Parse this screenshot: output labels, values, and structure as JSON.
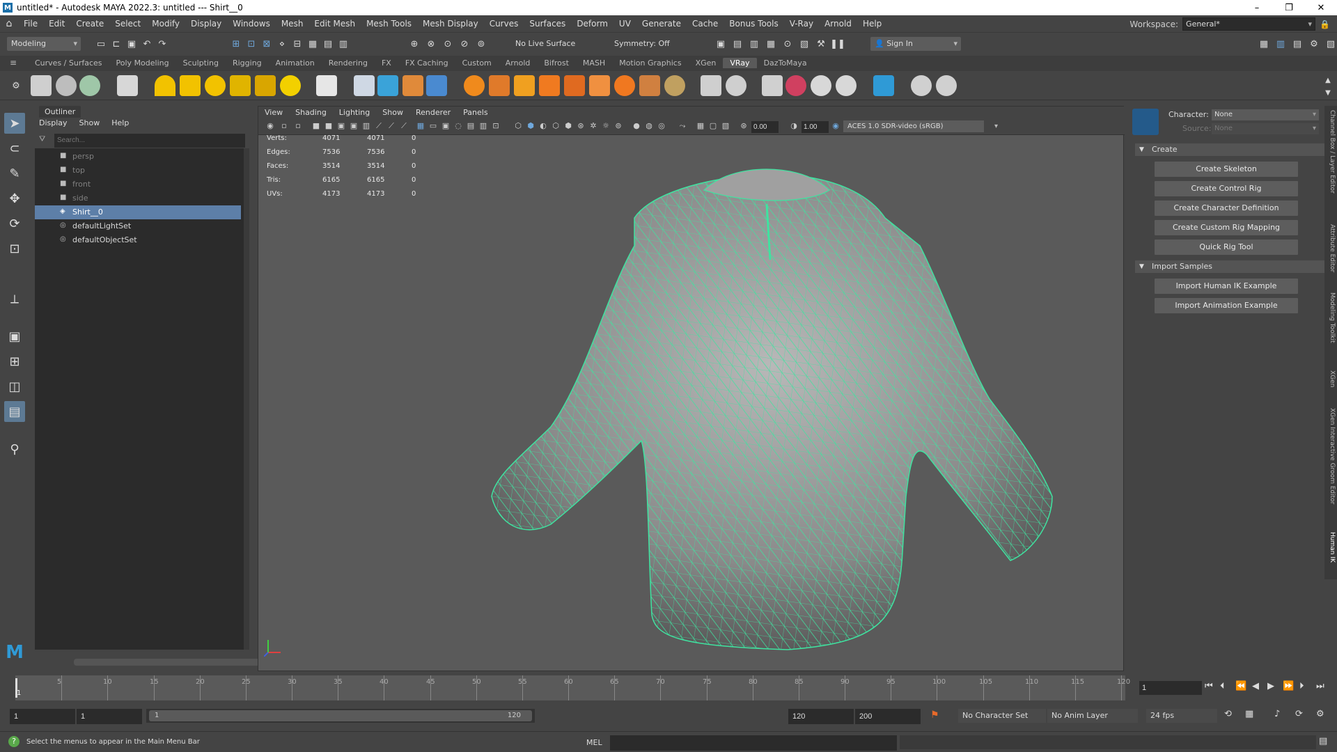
{
  "window": {
    "title": "untitled* - Autodesk MAYA 2022.3: untitled   ---   Shirt__0",
    "app_icon": "M",
    "controls": [
      "–",
      "❐",
      "✕"
    ]
  },
  "menubar": {
    "items": [
      "File",
      "Edit",
      "Create",
      "Select",
      "Modify",
      "Display",
      "Windows",
      "Mesh",
      "Edit Mesh",
      "Mesh Tools",
      "Mesh Display",
      "Curves",
      "Surfaces",
      "Deform",
      "UV",
      "Generate",
      "Cache",
      "Bonus Tools",
      "V-Ray",
      "Arnold",
      "Help"
    ],
    "workspace_label": "Workspace:",
    "workspace_value": "General*"
  },
  "statusline": {
    "mode": "Modeling",
    "live_surface": "No Live Surface",
    "symmetry": "Symmetry: Off",
    "sign_in": "Sign In"
  },
  "shelf": {
    "tabs": [
      "Curves / Surfaces",
      "Poly Modeling",
      "Sculpting",
      "Rigging",
      "Animation",
      "Rendering",
      "FX",
      "FX Caching",
      "Custom",
      "Arnold",
      "Bifrost",
      "MASH",
      "Motion Graphics",
      "XGen",
      "VRay",
      "DazToMaya"
    ],
    "active_tab": "VRay"
  },
  "outliner": {
    "title": "Outliner",
    "menu": [
      "Display",
      "Show",
      "Help"
    ],
    "search_placeholder": "Search...",
    "items": [
      {
        "label": "persp",
        "type": "camera"
      },
      {
        "label": "top",
        "type": "camera"
      },
      {
        "label": "front",
        "type": "camera"
      },
      {
        "label": "side",
        "type": "camera"
      },
      {
        "label": "Shirt__0",
        "type": "mesh",
        "selected": true
      },
      {
        "label": "defaultLightSet",
        "type": "set"
      },
      {
        "label": "defaultObjectSet",
        "type": "set"
      }
    ]
  },
  "viewport": {
    "menu": [
      "View",
      "Shading",
      "Lighting",
      "Show",
      "Renderer",
      "Panels"
    ],
    "exposure": "0.00",
    "gamma": "1.00",
    "color_space": "ACES 1.0 SDR-video (sRGB)",
    "hud": [
      {
        "label": "Verts:",
        "a": "4071",
        "b": "4071",
        "c": "0"
      },
      {
        "label": "Edges:",
        "a": "7536",
        "b": "7536",
        "c": "0"
      },
      {
        "label": "Faces:",
        "a": "3514",
        "b": "3514",
        "c": "0"
      },
      {
        "label": "Tris:",
        "a": "6165",
        "b": "6165",
        "c": "0"
      },
      {
        "label": "UVs:",
        "a": "4173",
        "b": "4173",
        "c": "0"
      }
    ],
    "wire_color": "#3fe3a0"
  },
  "human_ik": {
    "character_label": "Character:",
    "character_value": "None",
    "source_label": "Source:",
    "source_value": "None",
    "sections": [
      {
        "title": "Create",
        "buttons": [
          "Create Skeleton",
          "Create Control Rig",
          "Create Character Definition",
          "Create Custom Rig Mapping",
          "Quick Rig Tool"
        ]
      },
      {
        "title": "Import Samples",
        "buttons": [
          "Import Human IK Example",
          "Import Animation Example"
        ]
      }
    ],
    "side_tabs": [
      "Channel Box / Layer Editor",
      "Attribute Editor",
      "Modeling Toolkit",
      "XGen",
      "XGen Interactive Groom Editor",
      "Human IK"
    ]
  },
  "timeline": {
    "ticks": [
      "5",
      "10",
      "15",
      "20",
      "25",
      "30",
      "35",
      "40",
      "45",
      "50",
      "55",
      "60",
      "65",
      "70",
      "75",
      "80",
      "85",
      "90",
      "95",
      "100",
      "105",
      "110",
      "115",
      "120"
    ],
    "start_marker": "1",
    "current_frame": "1"
  },
  "range": {
    "start": "1",
    "playback_start": "1",
    "slider_start": "1",
    "slider_end": "120",
    "playback_end": "120",
    "end": "200",
    "character_set": "No Character Set",
    "anim_layer": "No Anim Layer",
    "fps": "24 fps"
  },
  "commandline": {
    "help": "Select the menus to appear in the Main Menu Bar",
    "language": "MEL"
  }
}
